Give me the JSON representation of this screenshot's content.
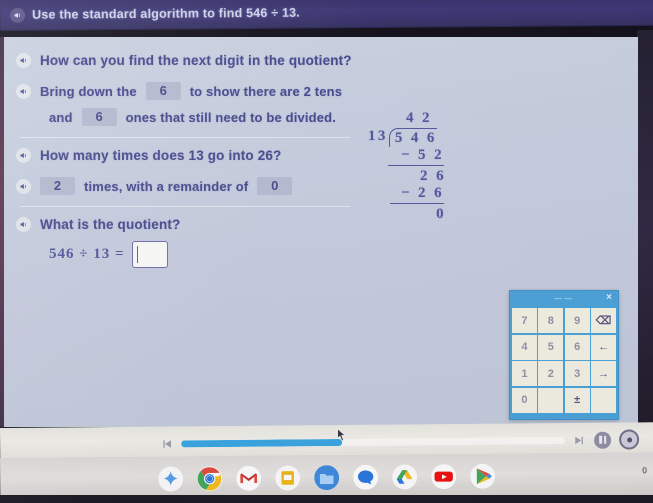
{
  "app": {
    "header_title": "Use the standard algorithm to find 546 ÷ 13.",
    "speaker_icon": "speaker-icon"
  },
  "lesson": {
    "q1": "How can you find the next digit in the quotient?",
    "a1_pre": "Bring down the",
    "a1_chip": "6",
    "a1_mid": "to show there are 2 tens",
    "a1_line2_pre": "and",
    "a1_chip2": "6",
    "a1_line2_post": "ones that still need to be divided.",
    "q2": "How many times does 13 go into 26?",
    "a2_chip": "2",
    "a2_mid": "times, with a remainder of",
    "a2_chip2": "0",
    "q3": "What is the quotient?",
    "equation": "546 ÷ 13 =",
    "answer_value": "",
    "answer_placeholder": ""
  },
  "long_division": {
    "quotient": "4 2",
    "divisor": "13",
    "dividend": "5 4 6",
    "subtract1": "− 5 2",
    "remainder1": "2 6",
    "subtract2": "− 2 6",
    "remainder2": "0"
  },
  "keypad": {
    "title": "——",
    "close_label": "×",
    "keys": [
      {
        "label": "7",
        "name": "key-7",
        "type": "digit"
      },
      {
        "label": "8",
        "name": "key-8",
        "type": "digit"
      },
      {
        "label": "9",
        "name": "key-9",
        "type": "digit"
      },
      {
        "label": "⌫",
        "name": "key-backspace",
        "type": "icon"
      },
      {
        "label": "4",
        "name": "key-4",
        "type": "digit"
      },
      {
        "label": "5",
        "name": "key-5",
        "type": "digit"
      },
      {
        "label": "6",
        "name": "key-6",
        "type": "digit"
      },
      {
        "label": "←",
        "name": "key-arrow-left",
        "type": "icon"
      },
      {
        "label": "1",
        "name": "key-1",
        "type": "digit"
      },
      {
        "label": "2",
        "name": "key-2",
        "type": "digit"
      },
      {
        "label": "3",
        "name": "key-3",
        "type": "digit"
      },
      {
        "label": "→",
        "name": "key-arrow-right",
        "type": "icon"
      },
      {
        "label": "0",
        "name": "key-0",
        "type": "digit"
      },
      {
        "label": "",
        "name": "key-blank-1",
        "type": "blank"
      },
      {
        "label": "±",
        "name": "key-plus-minus",
        "type": "icon"
      },
      {
        "label": "",
        "name": "key-blank-2",
        "type": "blank"
      }
    ]
  },
  "media": {
    "skip_back_icon": "skip-back-icon",
    "skip_forward_icon": "skip-forward-icon",
    "pause_icon": "pause-icon",
    "record_icon": "record-icon",
    "progress_percent": 42
  },
  "shelf": {
    "items": [
      {
        "name": "gemini-icon",
        "label": "Gemini"
      },
      {
        "name": "chrome-icon",
        "label": "Chrome"
      },
      {
        "name": "gmail-icon",
        "label": "Gmail"
      },
      {
        "name": "slides-icon",
        "label": "Slides"
      },
      {
        "name": "files-icon",
        "label": "Files"
      },
      {
        "name": "messages-icon",
        "label": "Messages"
      },
      {
        "name": "drive-icon",
        "label": "Drive"
      },
      {
        "name": "youtube-icon",
        "label": "YouTube"
      },
      {
        "name": "play-store-icon",
        "label": "Play Store"
      }
    ],
    "status_text": "0"
  },
  "colors": {
    "header_bg": "#2f2870",
    "card_bg": "#c6cfe3",
    "text_purple": "#3d3f8c",
    "keypad_blue": "#3b9fe0",
    "progress_blue": "#28a3e8"
  }
}
